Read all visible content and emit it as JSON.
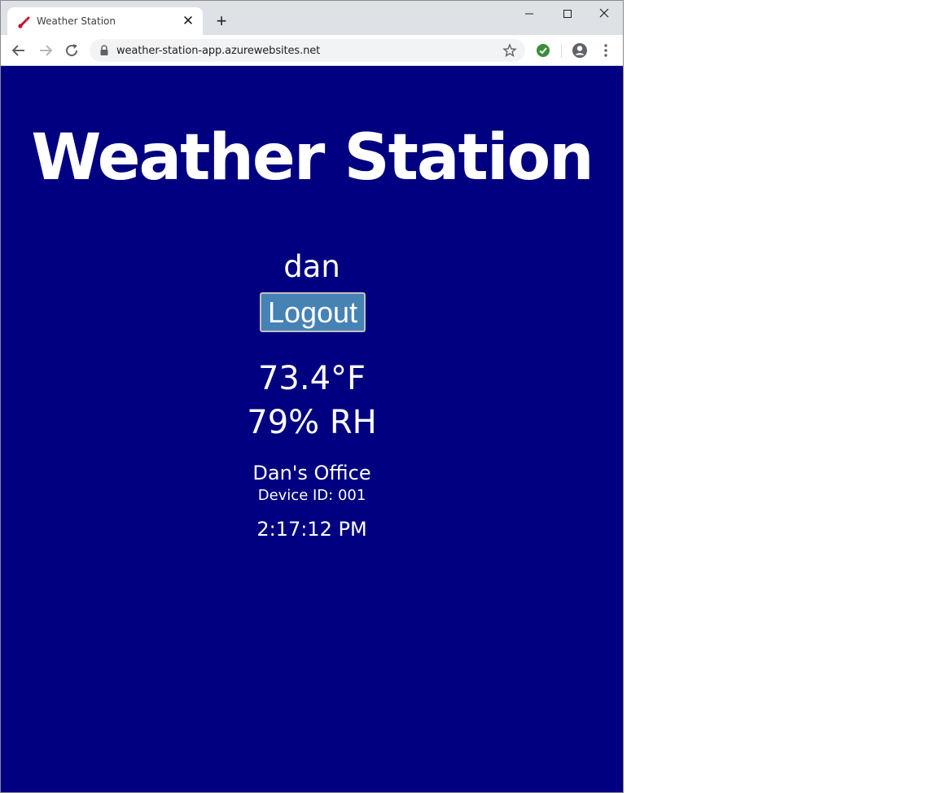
{
  "browser": {
    "tab_title": "Weather Station",
    "new_tab_icon": "plus-icon",
    "url": "weather-station-app.azurewebsites.net",
    "icons": [
      "thermometer-favicon",
      "close-icon",
      "back-arrow-icon",
      "forward-arrow-icon",
      "reload-icon",
      "lock-icon",
      "star-icon",
      "check-extension-icon",
      "profile-icon",
      "menu-icon"
    ],
    "colors": {
      "tabstrip": "#dee1e6",
      "omnibox": "#f1f3f4",
      "extension_green": "#3c8d3c"
    }
  },
  "page": {
    "title": "Weather Station",
    "user": "dan",
    "logout_label": "Logout",
    "temperature": "73.4°F",
    "humidity": "79% RH",
    "location": "Dan's Office",
    "device_id": "Device ID: 001",
    "time": "2:17:12 PM",
    "colors": {
      "background": "#000080",
      "text": "#ffffff",
      "button": "#4682b4"
    }
  }
}
